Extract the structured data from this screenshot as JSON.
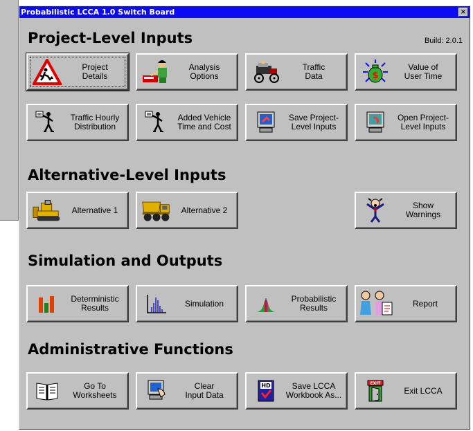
{
  "window": {
    "title": "Probabilistic LCCA 1.0 Switch Board",
    "close_label": "×",
    "build": "Build: 2.0.1"
  },
  "sections": {
    "project": "Project-Level Inputs",
    "alternative": "Alternative-Level Inputs",
    "simulation": "Simulation and Outputs",
    "admin": "Administrative Functions"
  },
  "buttons": {
    "project_details": "Project\nDetails",
    "analysis_options": "Analysis\nOptions",
    "traffic_data": "Traffic\nData",
    "value_of_user_time": "Value of\nUser Time",
    "traffic_hourly_distribution": "Traffic Hourly\nDistribution",
    "added_vehicle_time_cost": "Added Vehicle\nTime and Cost",
    "save_project_inputs": "Save Project-\nLevel Inputs",
    "open_project_inputs": "Open Project-\nLevel Inputs",
    "alternative_1": "Alternative 1",
    "alternative_2": "Alternative 2",
    "show_warnings": "Show\nWarnings",
    "deterministic_results": "Deterministic\nResults",
    "simulation": "Simulation",
    "probabilistic_results": "Probabilistic\nResults",
    "report": "Report",
    "go_to_worksheets": "Go To\nWorksheets",
    "clear_input_data": "Clear\nInput Data",
    "save_workbook_as": "Save LCCA\nWorkbook As...",
    "exit_lcca": "Exit LCCA"
  },
  "icons": {
    "project_details": "construction-warning-sign-icon",
    "analysis_options": "person-at-desk-icon",
    "traffic_data": "old-car-icon",
    "value_of_user_time": "money-bag-icon",
    "traffic_hourly_distribution": "walking-person-icon",
    "added_vehicle_time_cost": "walking-person-icon",
    "save_project_inputs": "computer-save-icon",
    "open_project_inputs": "computer-open-icon",
    "alternative_1": "bulldozer-icon",
    "alternative_2": "dump-truck-icon",
    "show_warnings": "shouting-man-icon",
    "deterministic_results": "bar-chart-icon",
    "simulation": "histogram-icon",
    "probabilistic_results": "distribution-icon",
    "report": "presenters-icon",
    "go_to_worksheets": "open-book-icon",
    "clear_input_data": "computer-hand-icon",
    "save_workbook_as": "save-workbook-icon",
    "exit_lcca": "exit-door-icon"
  },
  "colors": {
    "titlebar": "#0b0af0",
    "face": "#c0c0c0"
  }
}
